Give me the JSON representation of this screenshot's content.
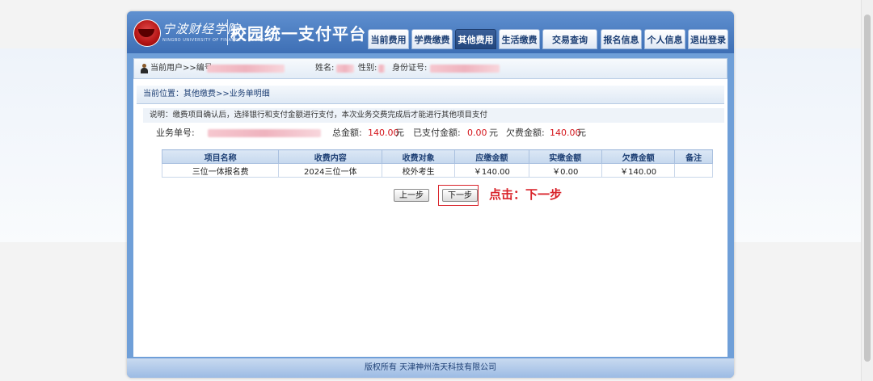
{
  "header": {
    "school_name": "宁波财经学院",
    "school_name_en": "NINGBO UNIVERSITY OF FINANCE & ECONOMICS",
    "platform_title": "校园统一支付平台"
  },
  "nav": {
    "tabs": [
      {
        "label": "当前费用",
        "active": false
      },
      {
        "label": "学费缴费",
        "active": false
      },
      {
        "label": "其他费用",
        "active": true
      },
      {
        "label": "生活缴费",
        "active": false
      },
      {
        "label": "交易查询",
        "active": false
      },
      {
        "label": "报名信息",
        "active": false
      },
      {
        "label": "个人信息",
        "active": false
      },
      {
        "label": "退出登录",
        "active": false
      }
    ]
  },
  "userbar": {
    "current_user_label": "当前用户>>编号:",
    "name_label": "姓名:",
    "gender_label": "性别:",
    "id_label": "身份证号:"
  },
  "location": {
    "text": "当前位置：其他缴费>>业务单明细"
  },
  "note": {
    "text": "说明：缴费项目确认后，选择银行和支付金额进行支付，本次业务交费完成后才能进行其他项目支付"
  },
  "business": {
    "order_label": "业务单号:",
    "total_label": "总金额:",
    "total_value": "140.00",
    "paid_label": "已支付金额:",
    "paid_value": "0.00",
    "owed_label": "欠费金额:",
    "owed_value": "140.00",
    "unit": "元"
  },
  "table": {
    "headers": [
      "项目名称",
      "收费内容",
      "收费对象",
      "应缴金额",
      "实缴金额",
      "欠费金额",
      "备注"
    ],
    "rows": [
      [
        "三位一体报名费",
        "2024三位一体",
        "校外考生",
        "￥140.00",
        "￥0.00",
        "￥140.00",
        ""
      ]
    ]
  },
  "buttons": {
    "prev": "上一步",
    "next": "下一步"
  },
  "annotation": {
    "text": "点击：下一步",
    "color": "#d9232a"
  },
  "footer": {
    "text": "版权所有 天津神州浩天科技有限公司"
  }
}
